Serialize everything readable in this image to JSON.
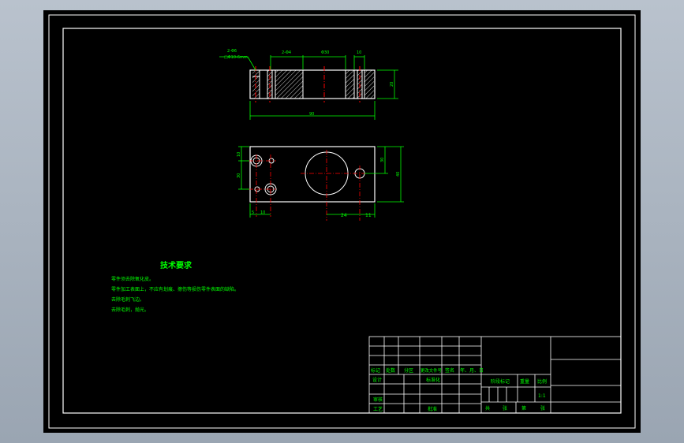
{
  "sheet": {
    "background": "#000000",
    "frame_color": "#ffffff",
    "geometry_color": "#ffffff",
    "dimension_color": "#00ff00",
    "centerline_color": "#ff0000",
    "hatch_color": "#ffffff",
    "background_outer": "#a9b3c0"
  },
  "dimensions": {
    "top_view": {
      "hole_callout_1": "2-Φ6",
      "hole_callout_2": "□Φ10-6mm",
      "label_2phi": "2-Φ4",
      "label_phi30": "Φ30",
      "label_10_top": "10",
      "label_height": "20",
      "label_width": "90"
    },
    "plan_view": {
      "label_10_left": "10",
      "label_30_left": "30",
      "label_30_right": "30",
      "label_40_right": "40",
      "label_5": "5",
      "label_10_bottom": "10",
      "label_24": "24",
      "label_11": "11"
    }
  },
  "notes": {
    "title": "技术要求",
    "lines": [
      "零件须去除氧化皮。",
      "零件加工表面上，不应有划痕、擦伤等损伤零件表面的缺陷。",
      "去除毛刺飞边。",
      "去除毛刺，抛光。"
    ]
  },
  "title_block": {
    "row_headers": [
      "标记",
      "处数",
      "分区",
      "更改文件号",
      "签名",
      "年、月、日"
    ],
    "design": "设计",
    "standardization": "标准化",
    "review": "审核",
    "process": "工艺",
    "approve": "批准",
    "stage_mark": "阶段标记",
    "weight": "重量",
    "scale": "比例",
    "scale_value": "1:1",
    "total": "共",
    "sheet_label_1": "张",
    "page": "第",
    "sheet_label_2": "张"
  }
}
